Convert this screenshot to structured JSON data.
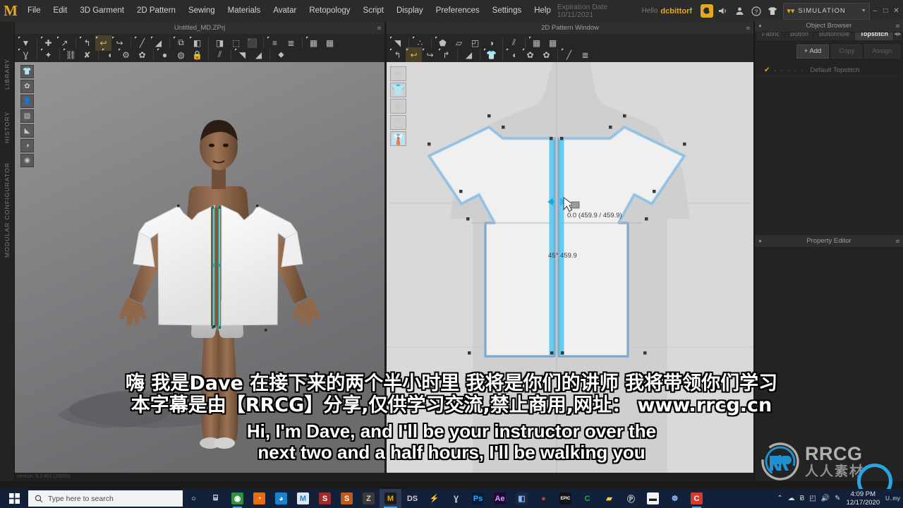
{
  "app": {
    "logo": "M",
    "document_title": "Untitled_MD.ZPrj",
    "expiration": "Expiration Date 10/11/2021",
    "hello_label": "Hello",
    "username": "dcbittorf",
    "mode": "SIMULATION",
    "version_status": "version: 5.1.401 (23696)"
  },
  "menubar": {
    "items": [
      {
        "label": "File"
      },
      {
        "label": "Edit"
      },
      {
        "label": "3D Garment"
      },
      {
        "label": "2D Pattern"
      },
      {
        "label": "Sewing"
      },
      {
        "label": "Materials"
      },
      {
        "label": "Avatar"
      },
      {
        "label": "Retopology"
      },
      {
        "label": "Script"
      },
      {
        "label": "Display"
      },
      {
        "label": "Preferences"
      },
      {
        "label": "Settings"
      },
      {
        "label": "Help"
      }
    ],
    "icons": [
      {
        "name": "notification-icon",
        "glyph": "◔"
      },
      {
        "name": "sound-icon",
        "glyph": "🔊"
      },
      {
        "name": "account-icon",
        "glyph": "👤"
      },
      {
        "name": "help-icon",
        "glyph": "?"
      },
      {
        "name": "garment-icon",
        "glyph": "👕"
      }
    ],
    "window_buttons": [
      {
        "name": "minimize",
        "glyph": "–"
      },
      {
        "name": "maximize",
        "glyph": "□"
      },
      {
        "name": "close",
        "glyph": "×"
      }
    ]
  },
  "left_dock": {
    "tabs": [
      "LIBRARY",
      "HISTORY",
      "MODULAR CONFIGURATOR"
    ]
  },
  "panels": {
    "viewport_3d_title": "Untitled_MD.ZPrj",
    "viewport_2d_title": "2D Pattern Window",
    "object_browser_title": "Object Browser",
    "property_editor_title": "Property Editor"
  },
  "object_browser": {
    "tabs": [
      {
        "label": "Fabric",
        "active": false
      },
      {
        "label": "Button",
        "active": false
      },
      {
        "label": "Buttonhole",
        "active": false
      },
      {
        "label": "Topstitch",
        "active": true
      }
    ],
    "scroll_left": "◀",
    "scroll_right": "▶",
    "buttons": [
      {
        "label": "+ Add",
        "enabled": true
      },
      {
        "label": "Copy",
        "enabled": false
      },
      {
        "label": "Assign",
        "enabled": false
      }
    ],
    "items": [
      {
        "checked": "✔",
        "dashes": "- - - - -",
        "label": "Default Topstitch"
      }
    ]
  },
  "toolbar_3d": {
    "row1": [
      {
        "name": "select-mesh-tool",
        "glyph": "▼",
        "arrow": true
      },
      {
        "sep": true
      },
      {
        "name": "move-tool",
        "glyph": "✚",
        "arrow": true
      },
      {
        "name": "transform-tool",
        "glyph": "↗",
        "arrow": true
      },
      {
        "sep": true
      },
      {
        "name": "fold-arrange-tool",
        "glyph": "↰",
        "arrow": true
      },
      {
        "name": "pin-tool",
        "glyph": "↩",
        "arrow": true,
        "active": true
      },
      {
        "name": "unfold-tool",
        "glyph": "↪",
        "arrow": true
      },
      {
        "sep": true
      },
      {
        "name": "segment-sewing-tool",
        "glyph": "╱",
        "arrow": true
      },
      {
        "name": "free-sewing-tool",
        "glyph": "◢",
        "arrow": true
      },
      {
        "sep": true
      },
      {
        "name": "pleat-tool",
        "glyph": "⧉",
        "arrow": true
      },
      {
        "name": "fold-tool",
        "glyph": "◧",
        "arrow": true
      },
      {
        "sep": true
      },
      {
        "name": "flatten-tool",
        "glyph": "◨"
      },
      {
        "name": "button-tool",
        "glyph": "⬚"
      },
      {
        "name": "buttonhole-tool",
        "glyph": "⬛"
      },
      {
        "sep": true
      },
      {
        "name": "zipper-tool",
        "glyph": "≡",
        "arrow": true
      },
      {
        "name": "topstitch-tool",
        "glyph": "≣"
      },
      {
        "sep": true
      },
      {
        "name": "grid-tool",
        "glyph": "▦",
        "arrow": true
      },
      {
        "name": "grid-large-tool",
        "glyph": "▦"
      }
    ],
    "row2": [
      {
        "name": "avatar-tool",
        "glyph": "Ɣ",
        "arrow": true
      },
      {
        "sep": true
      },
      {
        "name": "pose-tool",
        "glyph": "✦",
        "arrow": true
      },
      {
        "sep": true
      },
      {
        "name": "xray-joint-tool",
        "glyph": "⛓",
        "arrow": true
      },
      {
        "name": "skeleton-tool",
        "glyph": "✘"
      },
      {
        "sep": true
      },
      {
        "name": "tack-tool",
        "glyph": "◖",
        "arrow": true
      },
      {
        "name": "pressure-tool",
        "glyph": "⚙",
        "arrow": true
      },
      {
        "name": "fur-tool",
        "glyph": "✿"
      },
      {
        "sep": true
      },
      {
        "name": "circle-tool",
        "glyph": "●",
        "arrow": true
      },
      {
        "name": "sphere-tool",
        "glyph": "◍"
      },
      {
        "name": "lock-tool",
        "glyph": "🔒"
      },
      {
        "sep": true
      },
      {
        "name": "zipper-slider-tool",
        "glyph": "⫽"
      },
      {
        "sep": true
      },
      {
        "name": "surface-flatten-tool",
        "glyph": "◥",
        "arrow": true
      },
      {
        "name": "plane-tool",
        "glyph": "◢"
      },
      {
        "sep": true
      },
      {
        "name": "symmetry-tool",
        "glyph": "⬥"
      }
    ]
  },
  "toolbar_2d": {
    "row1": [
      {
        "name": "edit-pattern-tool",
        "glyph": "◥",
        "arrow": true
      },
      {
        "sep": true
      },
      {
        "name": "edit-curve-tool",
        "glyph": "∴",
        "arrow": true
      },
      {
        "sep": true
      },
      {
        "name": "polygon-tool",
        "glyph": "⬟",
        "arrow": true
      },
      {
        "name": "rectangle-tool",
        "glyph": "▱"
      },
      {
        "name": "internal-polygon-tool",
        "glyph": "◰"
      },
      {
        "name": "trace-tool",
        "glyph": "◑"
      },
      {
        "sep": true
      },
      {
        "name": "pleat-fold-tool",
        "glyph": "⫽"
      },
      {
        "sep": true
      },
      {
        "name": "grid-tool",
        "glyph": "▦",
        "arrow": true
      },
      {
        "name": "grid-large-tool",
        "glyph": "▦"
      }
    ],
    "row2": [
      {
        "name": "sew-segment-tool",
        "glyph": "↰",
        "arrow": true
      },
      {
        "name": "sew-free-tool",
        "glyph": "↩",
        "arrow": true,
        "active": true
      },
      {
        "name": "sew-auto-tool",
        "glyph": "↪",
        "arrow": true
      },
      {
        "name": "sew-copy-tool",
        "glyph": "↱",
        "arrow": true
      },
      {
        "sep": true
      },
      {
        "name": "fold-arrange-tool",
        "glyph": "◢"
      },
      {
        "sep": true
      },
      {
        "name": "garment-preview-tool",
        "glyph": "👕",
        "arrow": true
      },
      {
        "sep": true
      },
      {
        "name": "button-place-tool",
        "glyph": "◖",
        "arrow": true
      },
      {
        "name": "buttonhole-place-tool",
        "glyph": "✿",
        "arrow": true
      },
      {
        "name": "snap-tool",
        "glyph": "✿"
      },
      {
        "sep": true
      },
      {
        "name": "measure-tool",
        "glyph": "╱",
        "arrow": true
      },
      {
        "name": "topstitch-line-tool",
        "glyph": "≣"
      }
    ]
  },
  "viewport_3d": {
    "icon_stack": [
      {
        "name": "garment-display-icon",
        "glyph": "👕"
      },
      {
        "name": "fabric-display-icon",
        "glyph": "✿"
      },
      {
        "name": "avatar-display-icon",
        "glyph": "👤"
      },
      {
        "name": "texture-display-icon",
        "glyph": "▧"
      },
      {
        "name": "seam-display-icon",
        "glyph": "◣"
      },
      {
        "name": "mannequin-display-icon",
        "glyph": "◑"
      },
      {
        "name": "ball-display-icon",
        "glyph": "◉"
      }
    ]
  },
  "viewport_2d": {
    "icon_stack": [
      {
        "name": "pen-display-icon",
        "glyph": "✒"
      },
      {
        "name": "pattern-display-icon",
        "glyph": "👕"
      },
      {
        "name": "button-display-icon",
        "glyph": "◉"
      },
      {
        "name": "fold-display-icon",
        "glyph": "◫"
      },
      {
        "name": "garment-display-icon",
        "glyph": "👔"
      }
    ],
    "measurements": [
      {
        "name": "segment-length-readout",
        "text": "0.0 (459.9 / 459.9)"
      },
      {
        "name": "angle-length-readout",
        "text": "45°  459.9"
      }
    ]
  },
  "subtitles": {
    "line_cn_1": "嗨 我是Dave 在接下来的两个半小时里 我将是你们的讲师 我将带领你们学习",
    "line_cn_2": "本字幕是由【RRCG】分享,仅供学习交流,禁止商用,网址： www.rrcg.cn",
    "line_en_1": "Hi, I'm Dave, and I'll be your instructor over the",
    "line_en_2": "next two and a half hours, I'll be walking you"
  },
  "watermark": {
    "brand": "RRCG",
    "subtitle": "人人素材"
  },
  "taskbar": {
    "search_placeholder": "Type here to search",
    "items": [
      {
        "name": "cortana-icon",
        "glyph": "○",
        "color": "#ffffff",
        "bg": "transparent",
        "state": ""
      },
      {
        "name": "task-view-icon",
        "glyph": "⌸",
        "color": "#ffffff",
        "bg": "transparent",
        "state": ""
      },
      {
        "name": "chrome-icon",
        "glyph": "◉",
        "color": "#ffffff",
        "bg": "#2f8f43",
        "state": "run"
      },
      {
        "name": "firefox-icon",
        "glyph": "◔",
        "color": "#ffffff",
        "bg": "#e86b12",
        "state": ""
      },
      {
        "name": "edge-icon",
        "glyph": "◕",
        "color": "#ffffff",
        "bg": "#1b83c9",
        "state": ""
      },
      {
        "name": "marvelous-designer-icon",
        "glyph": "M",
        "color": "#2a7fc4",
        "bg": "#dfe8ef",
        "state": ""
      },
      {
        "name": "substance-painter-icon",
        "glyph": "S",
        "color": "#ffffff",
        "bg": "#9e2b2b",
        "state": ""
      },
      {
        "name": "substance-designer-icon",
        "glyph": "S",
        "color": "#ffffff",
        "bg": "#c05a1a",
        "state": ""
      },
      {
        "name": "zbrush-icon",
        "glyph": "Ζ",
        "color": "#cfcfcf",
        "bg": "#3a3a3a",
        "state": ""
      },
      {
        "name": "marvelous-designer-active-icon",
        "glyph": "M",
        "color": "#e0a921",
        "bg": "#1c1c1c",
        "state": "act"
      },
      {
        "name": "daz-studio-icon",
        "glyph": "DS",
        "color": "#cfcfcf",
        "bg": "transparent",
        "state": ""
      },
      {
        "name": "blender-icon",
        "glyph": "⚡",
        "color": "#e08b24",
        "bg": "transparent",
        "state": ""
      },
      {
        "name": "mixamo-icon",
        "glyph": "Ɣ",
        "color": "#cfcfcf",
        "bg": "transparent",
        "state": ""
      },
      {
        "name": "photoshop-icon",
        "glyph": "Ps",
        "color": "#31a8ff",
        "bg": "#001e36",
        "state": ""
      },
      {
        "name": "after-effects-icon",
        "glyph": "Ae",
        "color": "#d49cff",
        "bg": "#1f0a33",
        "state": ""
      },
      {
        "name": "lightroom-icon",
        "glyph": "◧",
        "color": "#7fb6ff",
        "bg": "#1b2a44",
        "state": ""
      },
      {
        "name": "poser-icon",
        "glyph": "●",
        "color": "#c43b3b",
        "bg": "transparent",
        "state": ""
      },
      {
        "name": "epic-games-icon",
        "glyph": "EPIC",
        "color": "#ffffff",
        "bg": "#121212",
        "state": ""
      },
      {
        "name": "cinema4d-icon",
        "glyph": "C",
        "color": "#2aa84a",
        "bg": "transparent",
        "state": ""
      },
      {
        "name": "file-explorer-icon",
        "glyph": "▰",
        "color": "#ffc83d",
        "bg": "transparent",
        "state": ""
      },
      {
        "name": "quixel-bridge-icon",
        "glyph": "Ⓟ",
        "color": "#cfcfcf",
        "bg": "transparent",
        "state": ""
      },
      {
        "name": "zoom-icon",
        "glyph": "▬",
        "color": "#1b1b1b",
        "bg": "#f2f2f2",
        "state": ""
      },
      {
        "name": "store-icon",
        "glyph": "☸",
        "color": "#8ab4f8",
        "bg": "transparent",
        "state": ""
      },
      {
        "name": "clip-studio-icon",
        "glyph": "C",
        "color": "#ffffff",
        "bg": "#d63a2a",
        "state": "run"
      }
    ],
    "tray": [
      {
        "name": "show-hidden-icons",
        "glyph": "⌃"
      },
      {
        "name": "onedrive-icon",
        "glyph": "☁"
      },
      {
        "name": "bluetooth-icon",
        "glyph": "Ƀ"
      },
      {
        "name": "network-icon",
        "glyph": "◰"
      },
      {
        "name": "volume-icon",
        "glyph": "🔊"
      },
      {
        "name": "pen-icon",
        "glyph": "✎"
      }
    ],
    "time": "4:09 PM",
    "date": "12/17/2020",
    "extra": "U..my"
  }
}
